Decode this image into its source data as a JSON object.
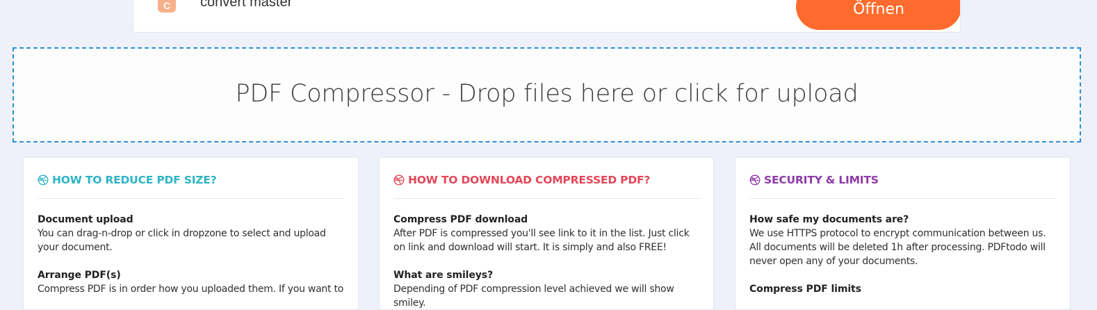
{
  "ad": {
    "logo_glyph": "C",
    "text": "convert master",
    "open_button": "Öffnen",
    "button_color": "#ff6b2c"
  },
  "dropzone": {
    "text": "PDF Compressor - Drop files here or click for upload",
    "border_color": "#2a8fd4"
  },
  "cards": [
    {
      "title": "HOW TO REDUCE PDF SIZE?",
      "icon": "dribbble-icon",
      "color": "#2eb4c6",
      "sections": [
        {
          "heading": "Document upload",
          "body": "You can drag-n-drop or click in dropzone to select and upload your document."
        },
        {
          "heading": "Arrange PDF(s)",
          "body": "Compress PDF is in order how you uploaded them. If you want to"
        }
      ]
    },
    {
      "title": "HOW TO DOWNLOAD COMPRESSED PDF?",
      "icon": "dribbble-icon",
      "color": "#e34758",
      "sections": [
        {
          "heading": "Compress PDF download",
          "body": "After PDF is compressed you'll see link to it in the list. Just click on link and download will start. It is simply and also FREE!"
        },
        {
          "heading": "What are smileys?",
          "body": "Depending of PDF compression level achieved we will show smiley."
        }
      ]
    },
    {
      "title": "SECURITY & LIMITS",
      "icon": "dribbble-icon",
      "color": "#8e3aa7",
      "sections": [
        {
          "heading": "How safe my documents are?",
          "body": "We use HTTPS protocol to encrypt communication between us. All documents will be deleted 1h after processing. PDFtodo will never open any of your documents."
        },
        {
          "heading": "Compress PDF limits",
          "body": ""
        }
      ]
    }
  ]
}
